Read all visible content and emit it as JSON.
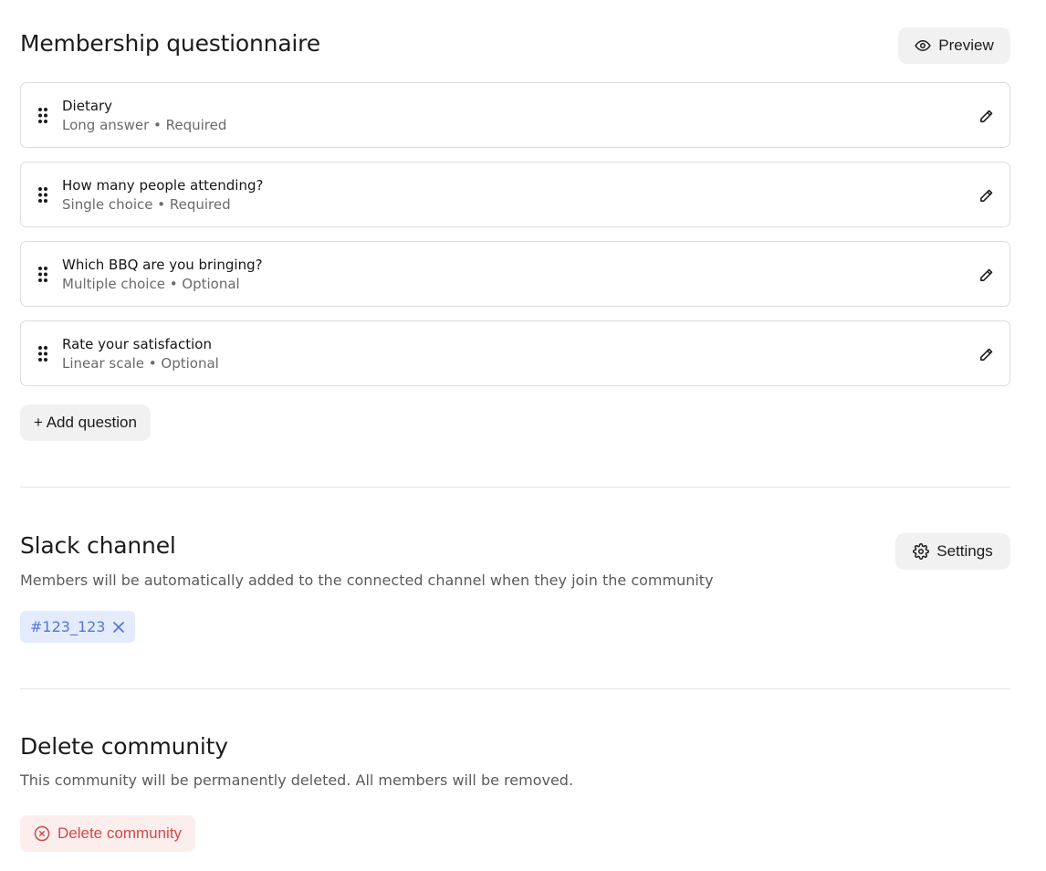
{
  "questionnaire": {
    "title": "Membership questionnaire",
    "preview_label": "Preview",
    "preview_icon": "eye-icon",
    "questions": [
      {
        "title": "Dietary",
        "type": "Long answer",
        "requirement": "Required",
        "subtitle": "Long answer • Required"
      },
      {
        "title": "How many people attending?",
        "type": "Single choice",
        "requirement": "Required",
        "subtitle": "Single choice • Required"
      },
      {
        "title": "Which BBQ are you bringing?",
        "type": "Multiple choice",
        "requirement": "Optional",
        "subtitle": "Multiple choice • Optional"
      },
      {
        "title": "Rate your satisfaction",
        "type": "Linear scale",
        "requirement": "Optional",
        "subtitle": "Linear scale • Optional"
      }
    ],
    "add_question_label": "+ Add question"
  },
  "slack": {
    "title": "Slack channel",
    "description": "Members will be automatically added to the connected channel when they join the community",
    "settings_label": "Settings",
    "settings_icon": "gear-icon",
    "channel": "#123_123",
    "channel_color": "#5777d6",
    "channel_bg": "#e3ebfc"
  },
  "delete": {
    "title": "Delete community",
    "description": "This community will be permanently deleted. All members will be removed.",
    "button_label": "Delete community",
    "button_icon": "circle-x-icon",
    "danger_color": "#cf4a4a"
  }
}
